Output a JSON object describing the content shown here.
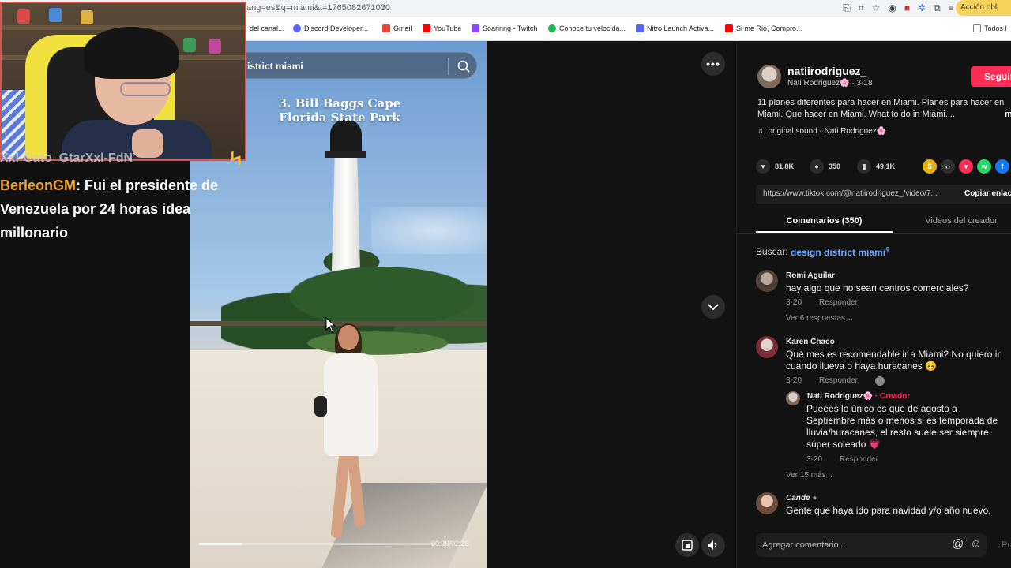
{
  "browser": {
    "url": "ang=es&q=miami&t=1765082671030",
    "action_badge": "Acción obli",
    "bookmarks": [
      {
        "label": "del canal...",
        "color": "#e0e0e0"
      },
      {
        "label": "Discord Developer...",
        "color": "#5865f2"
      },
      {
        "label": "Gmail",
        "color": "#ea4335"
      },
      {
        "label": "YouTube",
        "color": "#ff0000"
      },
      {
        "label": "Soarinng - Twitch",
        "color": "#9146ff"
      },
      {
        "label": "Conoce tu velocida...",
        "color": "#1db954"
      },
      {
        "label": "Nitro Launch Activa...",
        "color": "#5865f2"
      },
      {
        "label": "Si me Rio, Compro...",
        "color": "#ff0000"
      },
      {
        "label": "Todos l",
        "color": "#777777"
      }
    ]
  },
  "stream": {
    "chat_cut_line": "Xxl-Gato_GtarXxl-FdN",
    "chat_user": "BerleonGM",
    "chat_message": ": Fui el presidente de Venezuela por 24 horas idea millonario"
  },
  "video": {
    "search_text": "istrict miami",
    "title_line1": "3. Bill Baggs Cape",
    "title_line2": "Florida State Park",
    "timecode": "00:28/02:26",
    "progress": 0.18
  },
  "post": {
    "username": "natiirodriguez_",
    "display_name": "Nati Rodriguez🌸",
    "date": "3-18",
    "follow_label": "Seguir",
    "description": "11 planes diferentes para hacer en Miami. Planes para hacer en Miami. Que hacer en Miami. What to do in Miami....",
    "more_label": "m",
    "sound": "original sound - Nati Rodriguez🌸",
    "likes": "81.8K",
    "comments": "350",
    "saves": "49.1K",
    "link": "https://www.tiktok.com/@natiirodriguez_/video/7...",
    "copy_label": "Copiar enlace"
  },
  "tabs": {
    "comments": "Comentarios (350)",
    "creator_videos": "Videos del creador"
  },
  "search": {
    "label": "Buscar:",
    "term": "design district miami"
  },
  "comments": [
    {
      "name": "Romi Aguilar",
      "text": "hay algo que no sean centros comerciales?",
      "date": "3-20",
      "reply": "Responder",
      "more": "Ver 6 respuestas"
    },
    {
      "name": "Karen Chaco",
      "text": "Qué mes es recomendable ir a Miami? No quiero ir cuando llueva o haya huracanes 😣",
      "date": "3-20",
      "reply": "Responder"
    },
    {
      "name": "Nati Rodriguez🌸",
      "badge": "· Creador",
      "text": "Pueees lo único es que de agosto a Septiembre más o menos si es temporada de lluvia/huracanes, el resto suele ser siempre súper soleado 💗",
      "date": "3-20",
      "reply": "Responder",
      "more": "Ver 15 más"
    },
    {
      "name": "Cande",
      "text": "Gente que haya ido para navidad y/o año nuevo,"
    }
  ],
  "compose": {
    "placeholder": "Agregar comentario...",
    "post_label": "Pu"
  },
  "colors": {
    "accent": "#fe2c55",
    "link_blue": "#6ea8ff",
    "chat_user": "#f0a030"
  }
}
